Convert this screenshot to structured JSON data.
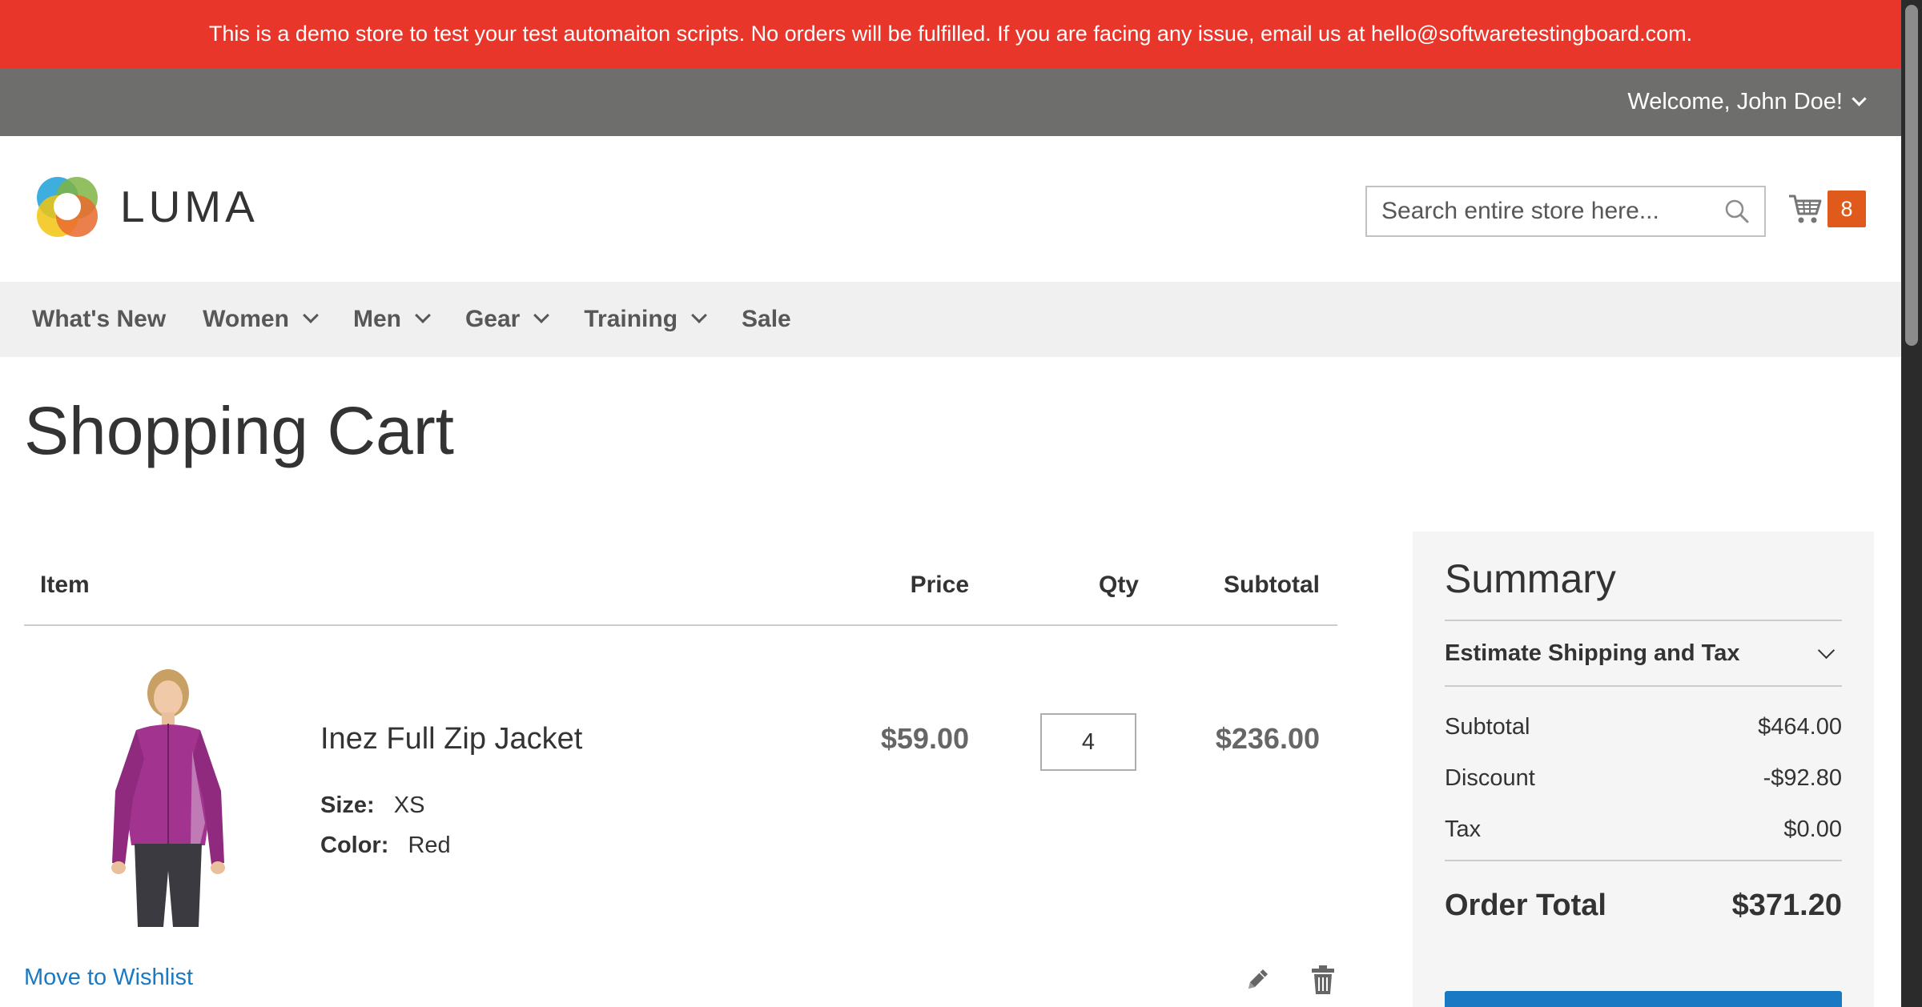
{
  "banner": {
    "text": "This is a demo store to test your test automaiton scripts. No orders will be fulfilled. If you are facing any issue, email us at hello@softwaretestingboard.com."
  },
  "account": {
    "welcome": "Welcome, John Doe!"
  },
  "header": {
    "logo_text": "LUMA",
    "search_placeholder": "Search entire store here...",
    "cart_count": "8",
    "cart_badge_color": "#e05b1b"
  },
  "nav": {
    "items": [
      {
        "label": "What's New",
        "has_dropdown": false
      },
      {
        "label": "Women",
        "has_dropdown": true
      },
      {
        "label": "Men",
        "has_dropdown": true
      },
      {
        "label": "Gear",
        "has_dropdown": true
      },
      {
        "label": "Training",
        "has_dropdown": true
      },
      {
        "label": "Sale",
        "has_dropdown": false
      }
    ]
  },
  "page": {
    "title": "Shopping Cart"
  },
  "cart_table": {
    "headers": {
      "item": "Item",
      "price": "Price",
      "qty": "Qty",
      "subtotal": "Subtotal"
    },
    "items": [
      {
        "name": "Inez Full Zip Jacket",
        "options": [
          {
            "label": "Size:",
            "value": "XS"
          },
          {
            "label": "Color:",
            "value": "Red"
          }
        ],
        "price": "$59.00",
        "qty": "4",
        "subtotal": "$236.00",
        "wishlist_link": "Move to Wishlist"
      }
    ]
  },
  "summary": {
    "title": "Summary",
    "estimate_label": "Estimate Shipping and Tax",
    "rows": [
      {
        "label": "Subtotal",
        "value": "$464.00"
      },
      {
        "label": "Discount",
        "value": "-$92.80"
      },
      {
        "label": "Tax",
        "value": "$0.00"
      }
    ],
    "order_total_label": "Order Total",
    "order_total_value": "$371.20"
  },
  "colors": {
    "banner": "#e8362b",
    "top_bar": "#6e6f6d",
    "link": "#1979c3",
    "primary_button": "#1979c3"
  }
}
